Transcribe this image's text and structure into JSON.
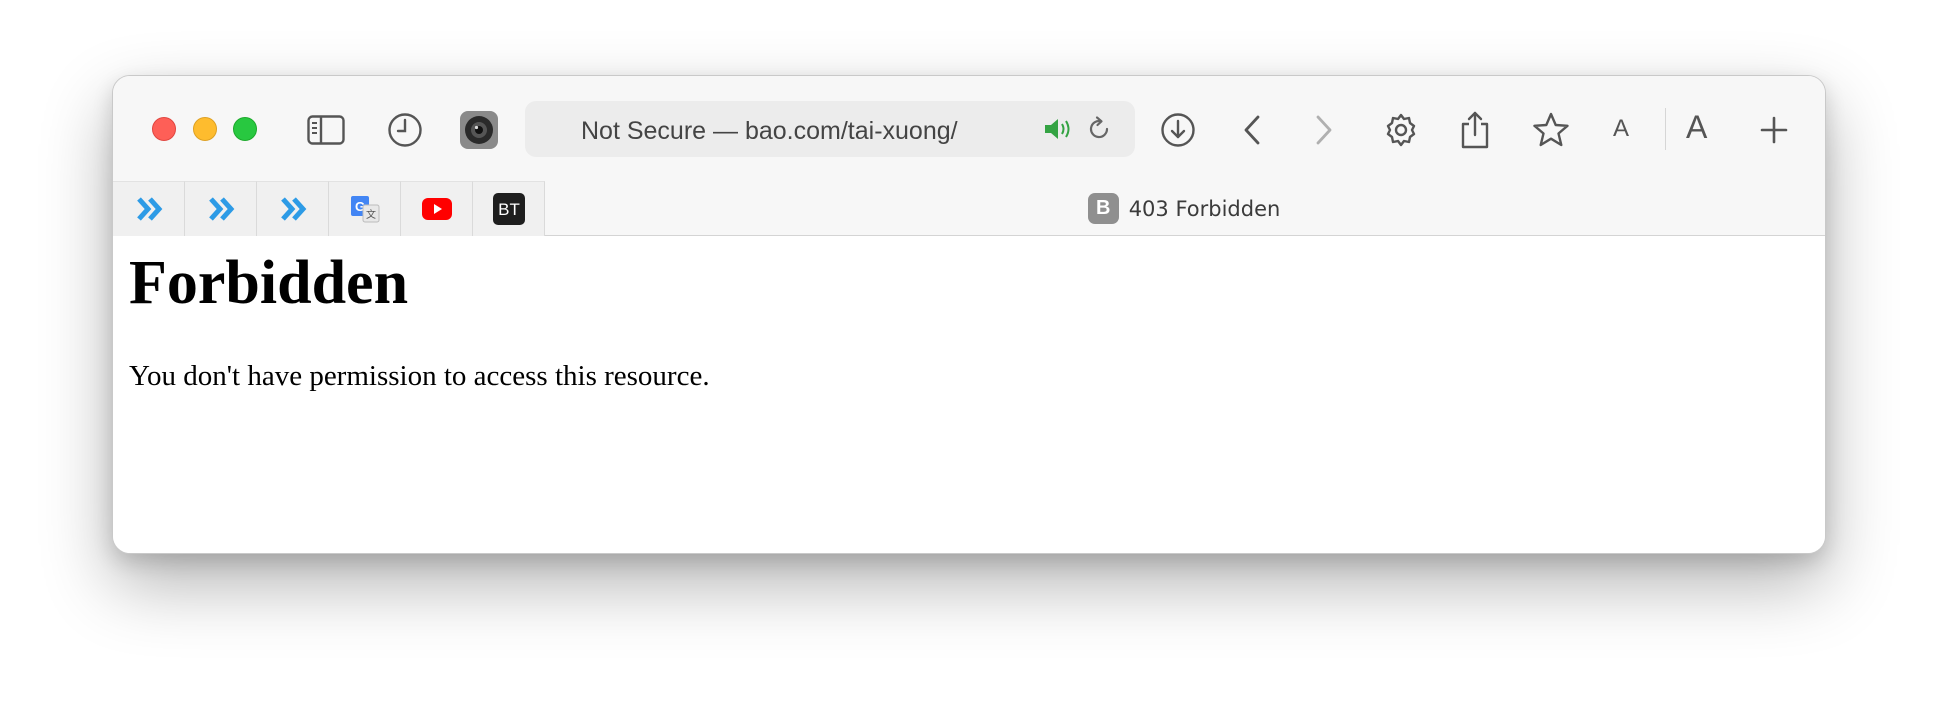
{
  "browser": {
    "address_bar": {
      "text": "Not Secure — bao.com/tai-xuong/"
    },
    "toolbar": {
      "font_small_label": "A",
      "font_large_label": "A"
    },
    "tabs": {
      "pinned": [
        {
          "icon": "forward-chevrons-icon",
          "color": "#2d9be6"
        },
        {
          "icon": "forward-chevrons-icon",
          "color": "#2d9be6"
        },
        {
          "icon": "forward-chevrons-icon",
          "color": "#2d9be6"
        },
        {
          "icon": "google-translate-icon",
          "color": "#4285f4"
        },
        {
          "icon": "youtube-icon",
          "color": "#ff0000"
        },
        {
          "icon": "bt-icon",
          "label": "BT"
        }
      ],
      "active": {
        "favicon_letter": "B",
        "title": "403 Forbidden"
      }
    }
  },
  "page": {
    "heading": "Forbidden",
    "message": "You don't have permission to access this resource."
  }
}
